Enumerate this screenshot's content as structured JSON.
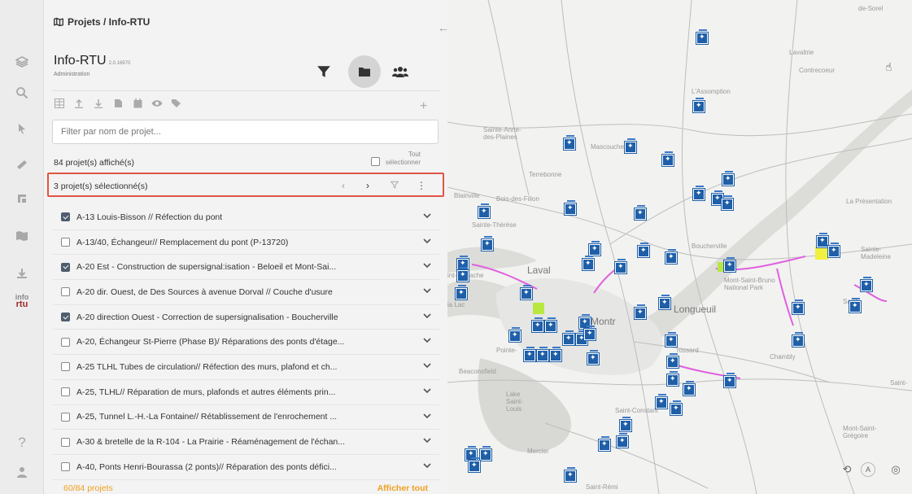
{
  "breadcrumb": "Projets / Info-RTU",
  "app": {
    "title": "Info-RTU",
    "version": "2.0.16970",
    "subtitle": "Administration"
  },
  "filter": {
    "placeholder": "Filter par nom de projet..."
  },
  "count_label": "84 projet(s) affiché(s)",
  "select_all_label": "Tout sélectionner",
  "selected_label": "3 projet(s) sélectionné(s)",
  "projects": [
    {
      "label": "A-13 Louis-Bisson // Réfection du pont",
      "checked": true
    },
    {
      "label": "A-13/40, Échangeur// Remplacement du pont (P-13720)",
      "checked": false
    },
    {
      "label": "A-20 Est - Construction de supersignal:isation - Beloeil et Mont-Sai...",
      "checked": true
    },
    {
      "label": "A-20 dir. Ouest, de Des Sources à avenue Dorval // Couche d'usure",
      "checked": false
    },
    {
      "label": "A-20 direction Ouest - Correction de supersignalisation - Boucherville",
      "checked": true
    },
    {
      "label": "A-20, Échangeur St-Pierre (Phase B)/ Réparations des ponts d'étage...",
      "checked": false
    },
    {
      "label": "A-25 TLHL Tubes de circulation// Réfection des murs, plafond et ch...",
      "checked": false
    },
    {
      "label": "A-25, TLHL// Réparation de murs, plafonds et autres éléments prin...",
      "checked": false
    },
    {
      "label": "A-25, Tunnel L.-H.-La Fontaine// Rétablissement de l'enrochement ...",
      "checked": false
    },
    {
      "label": "A-30 & bretelle de la R-104 - La Prairie - Réaménagement de l'échan...",
      "checked": false
    },
    {
      "label": "A-40, Ponts Henri-Bourassa (2 ponts)// Réparation des ponts défici...",
      "checked": false
    }
  ],
  "footer": {
    "count": "60/84 projets",
    "show_all": "Afficher tout"
  },
  "map": {
    "labels": {
      "laval": "Laval",
      "montreal": "Montr",
      "longueuil": "Longueuil",
      "terrebonne": "Terrebonne",
      "sainte_anne": "Sainte-Anne-des-Plaines",
      "mascouche": "Mascouche",
      "lassomption": "L'Assomption",
      "lavaltrie": "Lavaltrie",
      "contrecoeur": "Contrecoeur",
      "blainville": "Blainville",
      "bois_filion": "Bois-des-Filion",
      "boucherville": "Boucherville",
      "varennes": "Varennes",
      "la_presentation": "La Présentation",
      "sainte_madeleine": "Sainte-Madeleine",
      "mont_saint_bruno": "Mont-Saint-Bruno National Park",
      "chambly": "Chambly",
      "lake_saint_louis": "Lake Saint-Louis",
      "saint_constant": "Saint-Constant",
      "mercier": "Mercier",
      "mont_saint_gregoire": "Mont-Saint-Grégoire",
      "saint_remi": "Saint-Rémi",
      "de_sorel": "de-Sorel",
      "beaconsfield": "Beaconsfield",
      "pointe_claire": "Pointe-",
      "saint_jean": "Saint-",
      "saint_hyacinthe": "Saint-",
      "brossard": "rossard",
      "sainte_therese": "Sainte-Thérèse",
      "deux_montagnes": "int-Eustache",
      "oka": "ia Lac"
    }
  },
  "colors": {
    "accent": "#f0a020",
    "highlight": "#e05545",
    "marker": "#1f5fa8",
    "route": "#e060e0"
  }
}
